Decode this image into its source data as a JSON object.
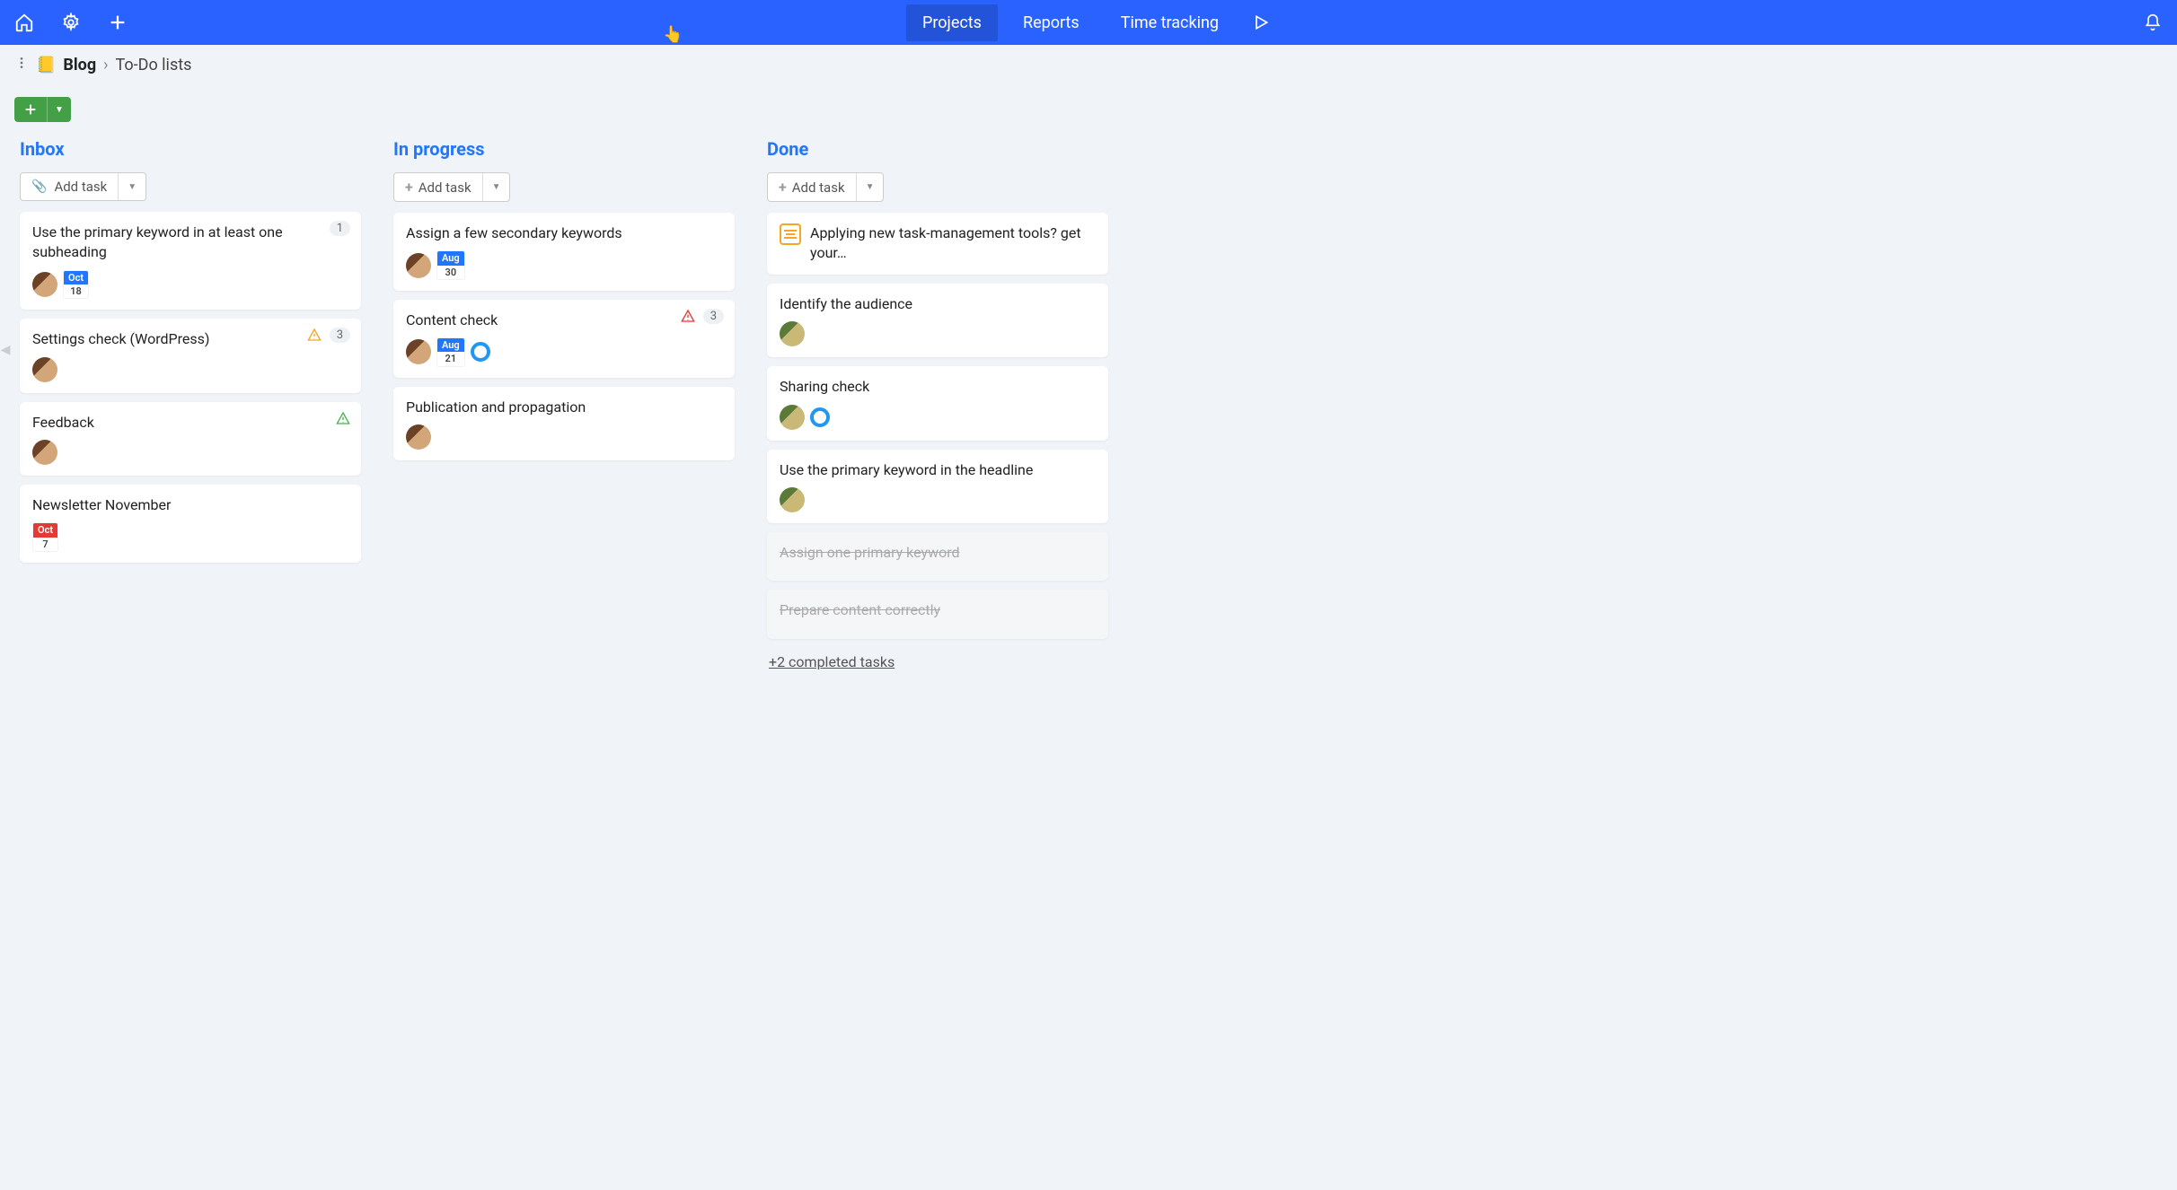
{
  "topbar": {
    "nav": {
      "projects": "Projects",
      "reports": "Reports",
      "time": "Time tracking"
    }
  },
  "breadcrumb": {
    "project_icon": "📒",
    "project": "Blog",
    "sep": "›",
    "sub": "To-Do lists"
  },
  "columns": [
    {
      "title": "Inbox",
      "add_label": "Add task",
      "has_clip": true,
      "cards": [
        {
          "title": "Use the primary keyword in at least one subheading",
          "avatar": "v1",
          "date_month": "Oct",
          "date_day": "18",
          "date_color": "blue",
          "count": "1"
        },
        {
          "title": "Settings check (WordPress)",
          "avatar": "v1",
          "warn": "orange",
          "count": "3"
        },
        {
          "title": "Feedback",
          "avatar": "v1",
          "warn": "green"
        },
        {
          "title": "Newsletter November",
          "date_month": "Oct",
          "date_day": "7",
          "date_color": "red"
        }
      ]
    },
    {
      "title": "In progress",
      "add_label": "Add task",
      "cards": [
        {
          "title": "Assign a few secondary keywords",
          "avatar": "v1",
          "date_month": "Aug",
          "date_day": "30",
          "date_color": "blue"
        },
        {
          "title": "Content check",
          "avatar": "v1",
          "date_month": "Aug",
          "date_day": "21",
          "date_color": "blue",
          "ring": true,
          "warn": "red",
          "count": "3"
        },
        {
          "title": "Publication and propagation",
          "avatar": "v1"
        }
      ]
    },
    {
      "title": "Done",
      "add_label": "Add task",
      "cards": [
        {
          "title": "Applying new task-management tools? get your…",
          "note": true
        },
        {
          "title": "Identify the audience",
          "avatar": "v2"
        },
        {
          "title": "Sharing check",
          "avatar": "v2",
          "ring": true
        },
        {
          "title": "Use the primary keyword in the headline",
          "avatar": "v2"
        },
        {
          "title": "Assign one primary keyword",
          "completed": true
        },
        {
          "title": "Prepare content correctly",
          "completed": true
        }
      ],
      "more": "+2 completed tasks"
    }
  ]
}
